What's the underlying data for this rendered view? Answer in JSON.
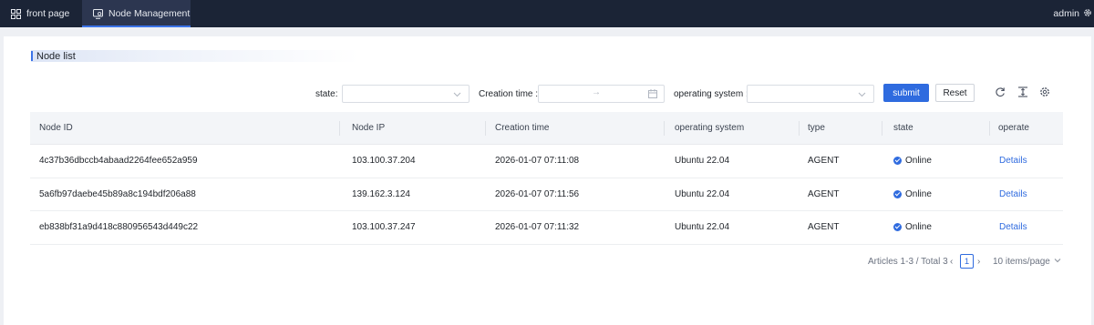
{
  "topbar": {
    "tabs": [
      {
        "label": "front page",
        "icon": "grid-icon"
      },
      {
        "label": "Node Management",
        "icon": "monitor-icon",
        "active": true
      }
    ],
    "user": "admin",
    "accent": "#3b73e8",
    "background": "#1b2436"
  },
  "section": {
    "title": "Node list"
  },
  "filters": {
    "state_label": "state",
    "state_value": "",
    "creation_time_label": "Creation time",
    "creation_time_start": "",
    "creation_time_end": "",
    "range_separator": "→",
    "os_label": "operating system",
    "os_value": "",
    "label_suffix": ":",
    "submit_label": "submit",
    "reset_label": "Reset"
  },
  "toolbar": {
    "icons": [
      "refresh-icon",
      "column-height-icon",
      "settings-icon"
    ]
  },
  "table": {
    "columns": [
      "Node ID",
      "Node IP",
      "Creation time",
      "operating system",
      "type",
      "state",
      "operate"
    ],
    "rows": [
      {
        "node_id": "4c37b36dbccb4abaad2264fee652a959",
        "node_ip": "103.100.37.204",
        "creation_time": "2026-01-07 07:11:08",
        "os": "Ubuntu 22.04",
        "type": "AGENT",
        "state": "Online",
        "operate": "Details"
      },
      {
        "node_id": "5a6fb97daebe45b89a8c194bdf206a88",
        "node_ip": "139.162.3.124",
        "creation_time": "2026-01-07 07:11:56",
        "os": "Ubuntu 22.04",
        "type": "AGENT",
        "state": "Online",
        "operate": "Details"
      },
      {
        "node_id": "eb838bf31a9d418c880956543d449c22",
        "node_ip": "103.100.37.247",
        "creation_time": "2026-01-07 07:11:32",
        "os": "Ubuntu 22.04",
        "type": "AGENT",
        "state": "Online",
        "operate": "Details"
      }
    ],
    "status_color": "#2f6bdf"
  },
  "pagination": {
    "summary": "Articles 1-3 / Total 3",
    "current_page": "1",
    "page_size": "10 items/page",
    "prev": "‹",
    "next": "›"
  }
}
